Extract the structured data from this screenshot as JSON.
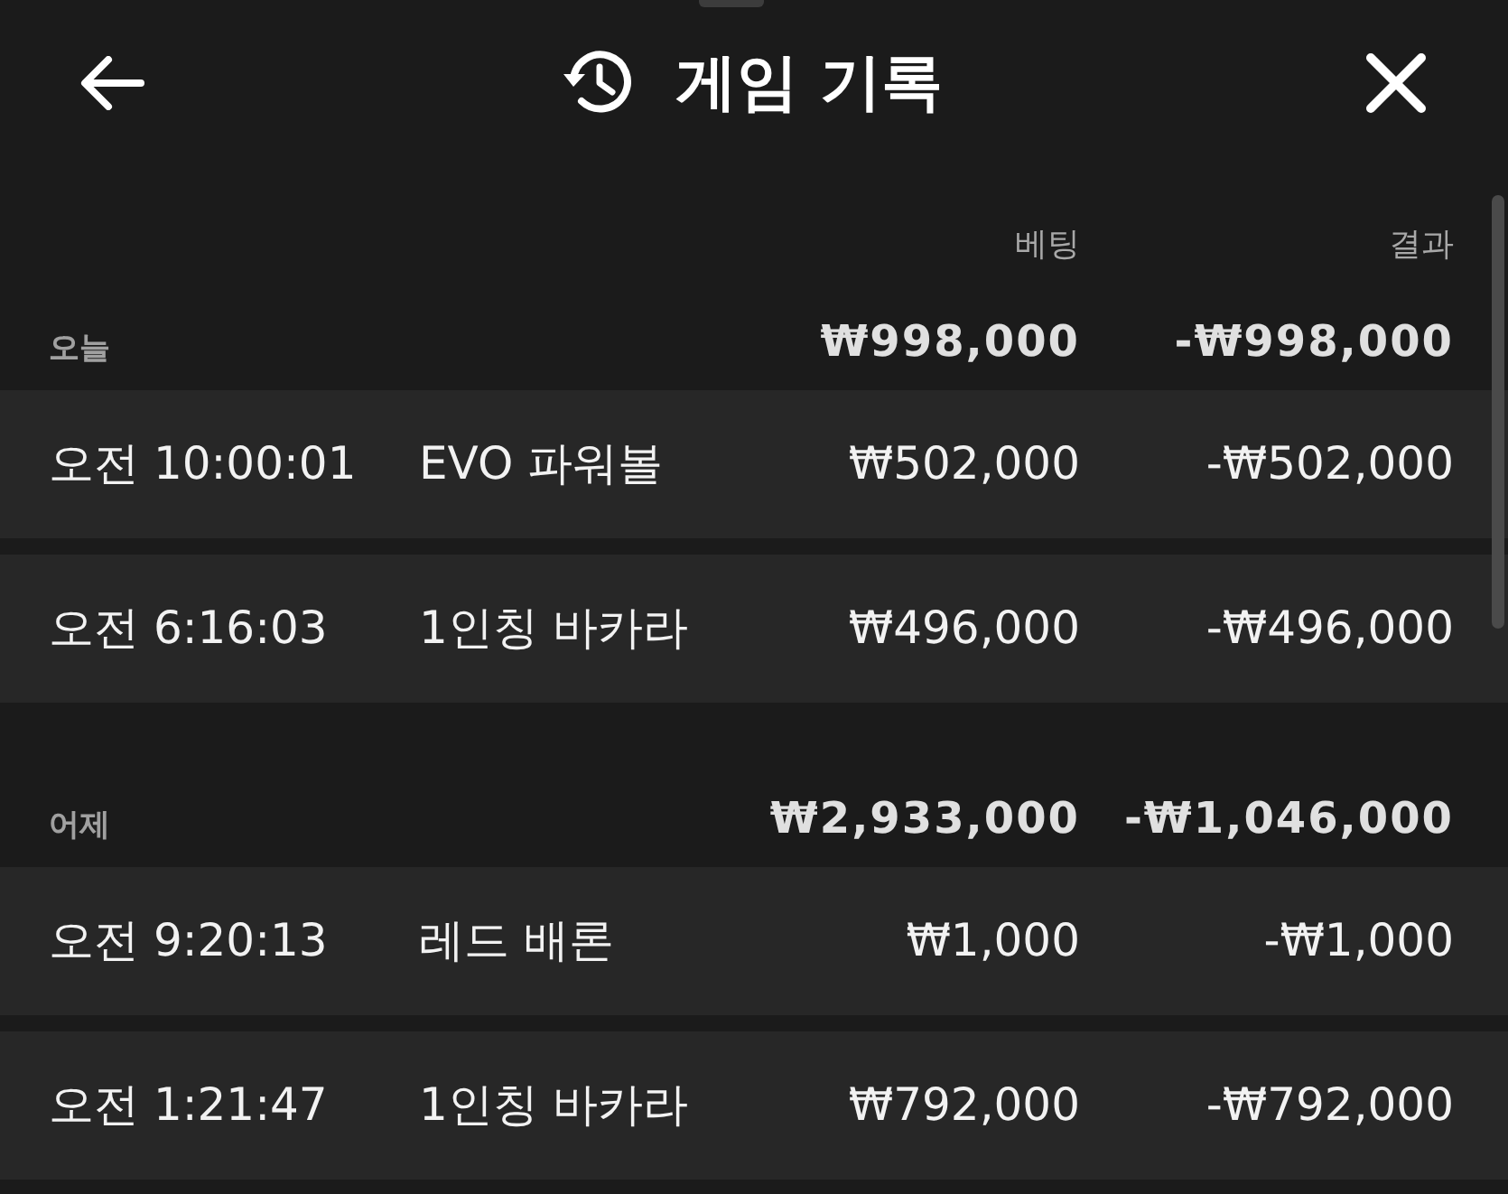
{
  "header": {
    "title": "게임 기록"
  },
  "columns": {
    "bet": "베팅",
    "result": "결과"
  },
  "groups": [
    {
      "label": "오늘",
      "total_bet": "₩998,000",
      "total_result": "-₩998,000",
      "rows": [
        {
          "time": "오전 10:00:01",
          "game": "EVO 파워볼",
          "bet": "₩502,000",
          "result": "-₩502,000"
        },
        {
          "time": "오전 6:16:03",
          "game": "1인칭 바카라",
          "bet": "₩496,000",
          "result": "-₩496,000"
        }
      ]
    },
    {
      "label": "어제",
      "total_bet": "₩2,933,000",
      "total_result": "-₩1,046,000",
      "rows": [
        {
          "time": "오전 9:20:13",
          "game": "레드 배론",
          "bet": "₩1,000",
          "result": "-₩1,000"
        },
        {
          "time": "오전 1:21:47",
          "game": "1인칭 바카라",
          "bet": "₩792,000",
          "result": "-₩792,000"
        }
      ]
    }
  ]
}
